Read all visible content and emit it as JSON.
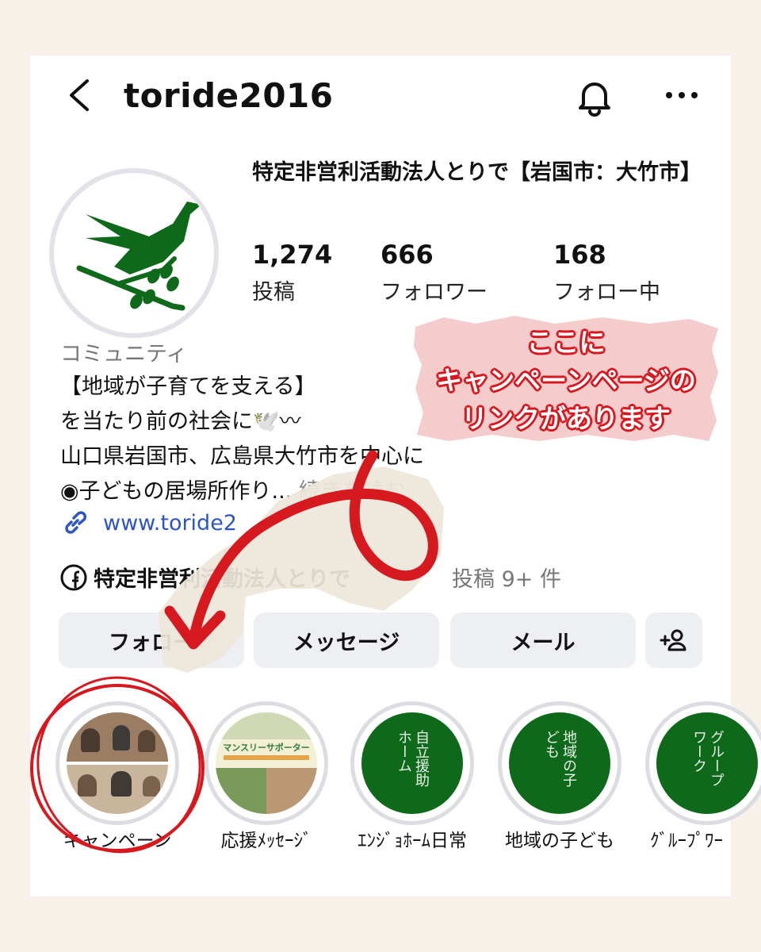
{
  "header": {
    "username": "toride2016"
  },
  "profile": {
    "display_name": "特定非営利活動法人とりで【岩国市：大竹市】",
    "stats": [
      {
        "value": "1,274",
        "label": "投稿"
      },
      {
        "value": "666",
        "label": "フォロワー"
      },
      {
        "value": "168",
        "label": "フォロー中"
      }
    ],
    "category": "コミュニティ",
    "bio": {
      "line1": "【地域が子育てを支える】",
      "line2": "を当たり前の社会に🕊️〰",
      "line3": "山口県岩国市、広島県大竹市を中心に",
      "line4": "◉子どもの居場所作り...",
      "more": "続きを読む"
    },
    "link": "www.toride2",
    "facebook": "特定非営利活動法人とりで",
    "posts_tag": "投稿 9+ 件"
  },
  "buttons": {
    "follow": "フォロー",
    "message": "メッセージ",
    "mail": "メール"
  },
  "highlights": [
    {
      "label": "キャンペーン"
    },
    {
      "label": "応援ﾒｯｾｰｼﾞ",
      "title": "マンスリーサポーター"
    },
    {
      "label": "ｴﾝｼﾞｮﾎｰﾑ日常",
      "text": "自立援助ホーム"
    },
    {
      "label": "地域の子ども",
      "text": "地域の子ども"
    },
    {
      "label": "ｸﾞﾙｰﾌﾟﾜｰ",
      "text": "グループワーク"
    }
  ],
  "callout": {
    "line1": "ここに",
    "line2": "キャンペーンページの",
    "line3": "リンクがあります"
  },
  "colors": {
    "brand_green": "#0e6a1a",
    "annotation_red": "#d6181f",
    "link_blue": "#2e55c4",
    "background": "#f8f1e9"
  }
}
